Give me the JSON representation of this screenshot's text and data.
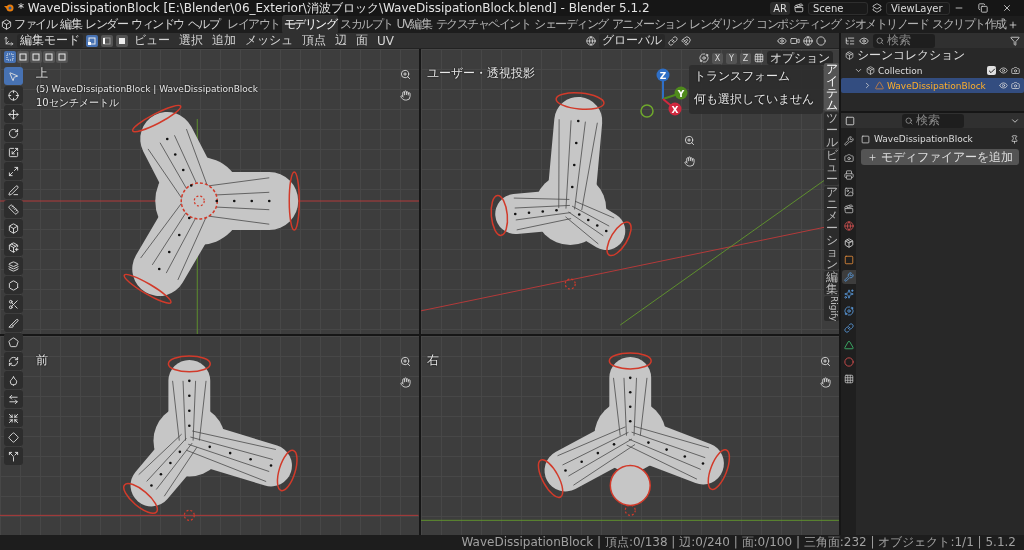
{
  "window": {
    "title": "* WaveDissipationBlock [E:\\Blender\\06_Exterior\\消波ブロック\\WaveDissipationBlock.blend] - Blender 5.1.2"
  },
  "menu": [
    "ファイル",
    "編集",
    "レンダー",
    "ウィンドウ",
    "ヘルプ"
  ],
  "workspaces": [
    {
      "label": "レイアウト",
      "selected": false
    },
    {
      "label": "モデリング",
      "selected": true
    },
    {
      "label": "スカルプト",
      "selected": false
    },
    {
      "label": "UV編集",
      "selected": false
    },
    {
      "label": "テクスチャペイント",
      "selected": false
    },
    {
      "label": "シェーディング",
      "selected": false
    },
    {
      "label": "アニメーション",
      "selected": false
    },
    {
      "label": "レンダリング",
      "selected": false
    },
    {
      "label": "コンポジティング",
      "selected": false
    },
    {
      "label": "ジオメトリノード",
      "selected": false
    },
    {
      "label": "スクリプト作成",
      "selected": false
    }
  ],
  "scene": {
    "ar": "AR",
    "name": "Scene",
    "view_layer": "ViewLayer"
  },
  "editor_header": {
    "mode": "編集モード",
    "menus": [
      "ビュー",
      "選択",
      "追加",
      "メッシュ",
      "頂点",
      "辺",
      "面",
      "UV"
    ],
    "orientation": "グローバル"
  },
  "select_modes": [
    {
      "kind": "vertex",
      "selected": true
    },
    {
      "kind": "edge",
      "selected": false
    },
    {
      "kind": "face",
      "selected": false
    }
  ],
  "tools": [
    {
      "kind": "select",
      "selected": true
    },
    {
      "kind": "cursor",
      "selected": false
    },
    {
      "kind": "move",
      "selected": false
    },
    {
      "kind": "rotate",
      "selected": false
    },
    {
      "kind": "scale",
      "selected": false
    },
    {
      "kind": "transform",
      "selected": false
    },
    {
      "kind": "annotate",
      "selected": false
    },
    {
      "kind": "measure",
      "selected": false
    },
    {
      "kind": "add",
      "selected": false
    },
    {
      "kind": "extrude",
      "selected": false
    },
    {
      "kind": "inset",
      "selected": false
    },
    {
      "kind": "bevel",
      "selected": false
    },
    {
      "kind": "loopcut",
      "selected": false
    },
    {
      "kind": "knife",
      "selected": false
    },
    {
      "kind": "polybuild",
      "selected": false
    },
    {
      "kind": "spin",
      "selected": false
    },
    {
      "kind": "smooth",
      "selected": false
    },
    {
      "kind": "slide",
      "selected": false
    },
    {
      "kind": "shrink",
      "selected": false
    },
    {
      "kind": "shear",
      "selected": false
    },
    {
      "kind": "rip",
      "selected": false
    }
  ],
  "viewports": [
    {
      "kind": "top",
      "label": "上",
      "info": [
        "(5) WaveDissipationBlock | WaveDissipationBlock",
        "10センチメートル"
      ]
    },
    {
      "kind": "persp",
      "label": "ユーザー・透視投影"
    },
    {
      "kind": "front",
      "label": "前"
    },
    {
      "kind": "side",
      "label": "右"
    }
  ],
  "viewport_options": {
    "axes": [
      "X",
      "Y",
      "Z"
    ],
    "options": "オプション"
  },
  "gizmo": [
    "Z",
    "Y",
    "X"
  ],
  "sidebar": {
    "panel": "トランスフォーム",
    "message": "何も選択していません",
    "tabs": [
      {
        "label": "アイテム",
        "selected": true
      },
      {
        "label": "ツール",
        "selected": false
      },
      {
        "label": "ビュー",
        "selected": false
      },
      {
        "label": "アニメーション",
        "selected": false
      },
      {
        "label": "編集",
        "selected": false
      },
      {
        "label": "Rigify",
        "selected": false
      }
    ]
  },
  "outliner": {
    "search_placeholder": "検索",
    "tree": [
      {
        "label": "シーンコレクション",
        "children": [
          {
            "label": "Collection",
            "expanded": true,
            "checked": true,
            "children": [
              {
                "label": "WaveDissipationBlock",
                "expanded": false,
                "selected": true
              }
            ]
          }
        ]
      }
    ]
  },
  "properties": {
    "search_placeholder": "検索",
    "object": "WaveDissipationBlock",
    "add_modifier": "モディファイアーを追加",
    "tabs": [
      {
        "kind": "tool",
        "selected": false
      },
      {
        "kind": "render",
        "selected": false
      },
      {
        "kind": "output",
        "selected": false
      },
      {
        "kind": "view",
        "selected": false
      },
      {
        "kind": "scene",
        "selected": false
      },
      {
        "kind": "world",
        "selected": false
      },
      {
        "kind": "collection",
        "selected": false
      },
      {
        "kind": "object",
        "selected": false
      },
      {
        "kind": "modifier",
        "selected": true
      },
      {
        "kind": "particles",
        "selected": false
      },
      {
        "kind": "physics",
        "selected": false
      },
      {
        "kind": "constraints",
        "selected": false
      },
      {
        "kind": "data",
        "selected": false
      },
      {
        "kind": "material",
        "selected": false
      },
      {
        "kind": "texture",
        "selected": false
      }
    ]
  },
  "status_bar": "WaveDissipationBlock | 頂点:0/138 | 辺:0/240 | 面:0/100 | 三角面:232 | オブジェクト:1/1 | 5.1.2"
}
